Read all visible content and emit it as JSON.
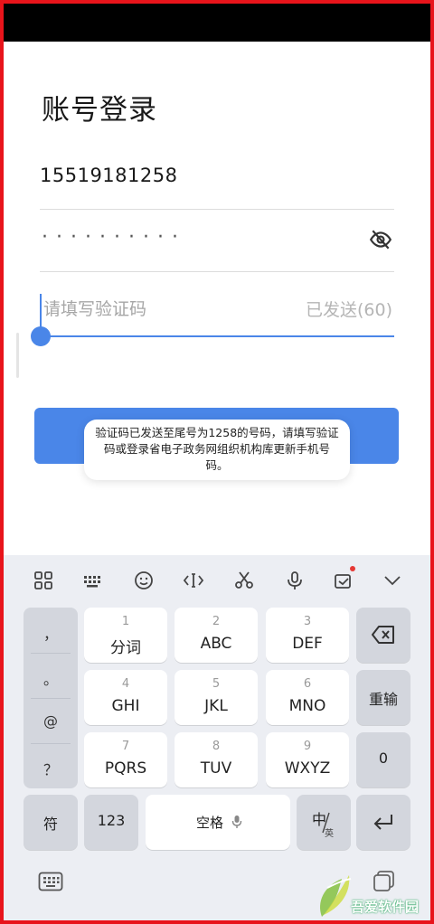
{
  "title": "账号登录",
  "phone": {
    "value": "15519181258"
  },
  "password": {
    "masked": "··········"
  },
  "code": {
    "placeholder": "请填写验证码",
    "status": "已发送(60)"
  },
  "toast": {
    "text": "验证码已发送至尾号为1258的号码，请填写验证码或登录省电子政务网组织机构库更新手机号码。"
  },
  "keyboard": {
    "symbols": [
      "，",
      "。",
      "@",
      "？"
    ],
    "keys": [
      {
        "num": "1",
        "letters": "分词"
      },
      {
        "num": "2",
        "letters": "ABC"
      },
      {
        "num": "3",
        "letters": "DEF"
      },
      {
        "num": "4",
        "letters": "GHI"
      },
      {
        "num": "5",
        "letters": "JKL"
      },
      {
        "num": "6",
        "letters": "MNO"
      },
      {
        "num": "7",
        "letters": "PQRS"
      },
      {
        "num": "8",
        "letters": "TUV"
      },
      {
        "num": "9",
        "letters": "WXYZ"
      }
    ],
    "reenter": "重输",
    "zero": "0",
    "fu": "符",
    "num_mode": "123",
    "space": "空格",
    "lang_main": "中",
    "lang_sub": "英"
  },
  "watermark": {
    "text": "吾爱软件园",
    "icon": "leaf-logo-icon"
  },
  "colors": {
    "accent": "#4a86e8",
    "frame": "#e8141b",
    "keyboard_bg": "#eceef3"
  }
}
